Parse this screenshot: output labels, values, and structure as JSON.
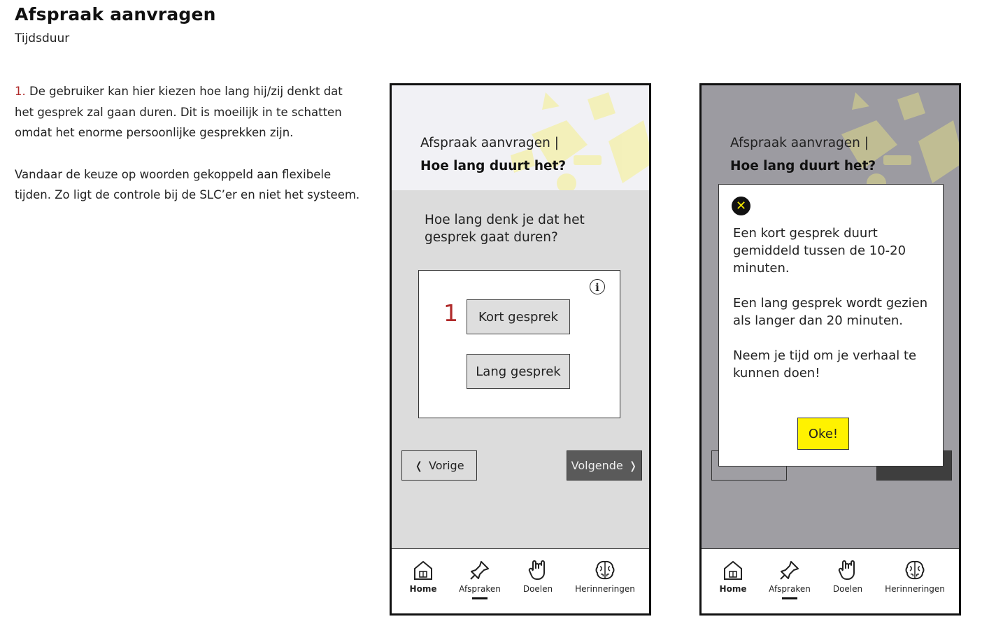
{
  "page": {
    "title": "Afspraak aanvragen",
    "subtitle": "Tijdsduur",
    "note_number": "1.",
    "note_text_1": " De gebruiker kan hier kiezen hoe lang hij/zij denkt dat het gesprek zal gaan duren. Dit is moeilijk in te schatten omdat het enorme persoonlijke gesprekken zijn.",
    "note_text_2": "Vandaar de keuze op woorden gekoppeld aan flexibele tijden. Zo ligt de controle bij de SLC’er en niet het systeem."
  },
  "screen": {
    "header_line1": "Afspraak aanvragen |",
    "header_line2": "Hoe lang duurt het?",
    "question": "Hoe lang denk je dat het gesprek gaat duren?",
    "annotation_marker": "1",
    "option_short": "Kort gesprek",
    "option_long": "Lang gesprek",
    "info_icon_glyph": "i",
    "prev_label": "Vorige",
    "next_label": "Volgende",
    "prev_chevron": "❬",
    "next_chevron": "❭"
  },
  "nav": {
    "items": [
      {
        "label": "Home",
        "icon": "house-icon",
        "active": false
      },
      {
        "label": "Afspraken",
        "icon": "pushpin-icon",
        "active": true
      },
      {
        "label": "Doelen",
        "icon": "hand-icon",
        "active": false
      },
      {
        "label": "Herinneringen",
        "icon": "brain-icon",
        "active": false
      }
    ]
  },
  "modal": {
    "close_glyph": "✕",
    "paragraph_1": "Een kort gesprek duurt gemiddeld tussen de 10-20 minuten.",
    "paragraph_2": "Een lang gesprek wordt gezien als langer dan 20 minuten.",
    "paragraph_3": "Neem je tijd om je verhaal te kunnen doen!",
    "ok_label": "Oke!"
  },
  "colors": {
    "accent_red": "#b02a2a",
    "accent_yellow": "#fff200",
    "next_button": "#5a5a5a",
    "overlay_gray": "#9f9ea3"
  }
}
